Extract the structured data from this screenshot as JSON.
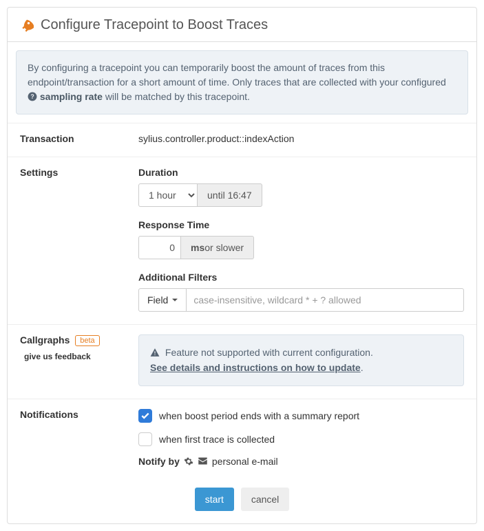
{
  "header": {
    "title": "Configure Tracepoint to Boost Traces"
  },
  "info": {
    "text_before": "By configuring a tracepoint you can temporarily boost the amount of traces from this endpoint/transaction for a short amount of time. Only traces that are collected with your configured ",
    "link_text": "sampling rate",
    "text_after": " will be matched by this tracepoint."
  },
  "transaction": {
    "label": "Transaction",
    "value": "sylius.controller.product::indexAction"
  },
  "settings": {
    "label": "Settings",
    "duration": {
      "label": "Duration",
      "value": "1 hour",
      "until": "until 16:47"
    },
    "response_time": {
      "label": "Response Time",
      "value": "0",
      "unit": "ms",
      "suffix": " or slower"
    },
    "filters": {
      "label": "Additional Filters",
      "field_btn": "Field",
      "placeholder": "case-insensitive, wildcard * + ? allowed"
    }
  },
  "callgraphs": {
    "label": "Callgraphs",
    "badge": "beta",
    "feedback": "give us feedback",
    "warn_text": "Feature not supported with current configuration.",
    "warn_link": "See details and instructions on how to update"
  },
  "notifications": {
    "label": "Notifications",
    "opt_summary": "when boost period ends with a summary report",
    "opt_first": "when first trace is collected",
    "notify_by": "Notify by",
    "email": "personal e-mail"
  },
  "actions": {
    "start": "start",
    "cancel": "cancel"
  }
}
